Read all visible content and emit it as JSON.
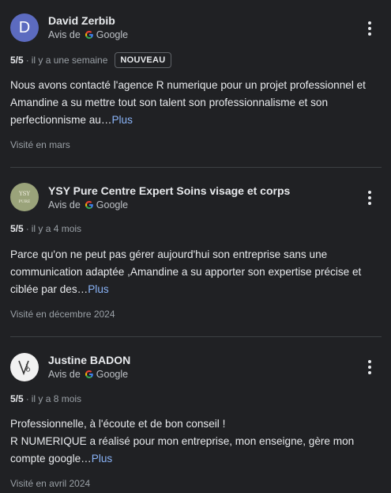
{
  "reviews": [
    {
      "author": "David Zerbib",
      "avatar_letter": "D",
      "source_prefix": "Avis de",
      "source_name": "Google",
      "rating": "5/5",
      "time": "il y a une semaine",
      "badge": "NOUVEAU",
      "text": "Nous avons contacté l'agence R numerique pour un projet professionnel et Amandine a su mettre tout son talent son professionnalisme et son perfectionnisme au…",
      "more_label": "Plus",
      "visited": "Visité en mars"
    },
    {
      "author": "YSY Pure Centre Expert Soins visage et corps",
      "avatar_text_top": "YSY",
      "avatar_text_bottom": "PURE",
      "source_prefix": "Avis de",
      "source_name": "Google",
      "rating": "5/5",
      "time": "il y a 4 mois",
      "text": "Parce qu'on ne peut pas gérer aujourd'hui son entreprise sans une communication adaptée ,Amandine a su apporter son expertise précise et ciblée par des…",
      "more_label": "Plus",
      "visited": "Visité en décembre 2024"
    },
    {
      "author": "Justine BADON",
      "source_prefix": "Avis de",
      "source_name": "Google",
      "rating": "5/5",
      "time": "il y a 8 mois",
      "text_line1": "Professionnelle, à l'écoute et de bon conseil !",
      "text_rest": "R NUMERIQUE a réalisé pour mon entreprise, mon enseigne, gère mon compte google…",
      "more_label": "Plus",
      "visited": "Visité en avril 2024"
    }
  ],
  "colors": {
    "background": "#202124",
    "link": "#8ab4f8",
    "avatar_david": "#5c6bc0"
  }
}
